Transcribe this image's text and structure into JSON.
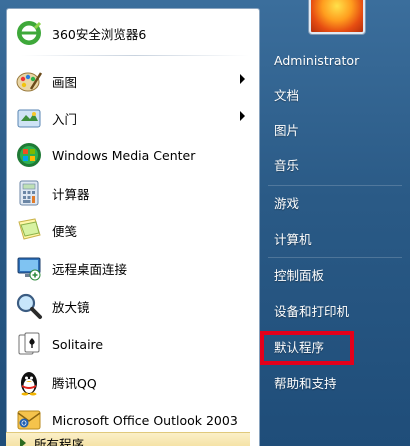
{
  "pinned": [
    {
      "label": "360安全浏览器6",
      "icon": "360-browser-icon"
    }
  ],
  "programs": [
    {
      "label": "画图",
      "icon": "paint-icon",
      "submenu": true
    },
    {
      "label": "入门",
      "icon": "getting-started-icon",
      "submenu": true
    },
    {
      "label": "Windows Media Center",
      "icon": "media-center-icon",
      "submenu": false
    },
    {
      "label": "计算器",
      "icon": "calculator-icon",
      "submenu": false
    },
    {
      "label": "便笺",
      "icon": "sticky-notes-icon",
      "submenu": false
    },
    {
      "label": "远程桌面连接",
      "icon": "remote-desktop-icon",
      "submenu": false
    },
    {
      "label": "放大镜",
      "icon": "magnifier-icon",
      "submenu": false
    },
    {
      "label": "Solitaire",
      "icon": "solitaire-icon",
      "submenu": false
    },
    {
      "label": "腾讯QQ",
      "icon": "qq-penguin-icon",
      "submenu": false
    },
    {
      "label": "Microsoft Office Outlook 2003",
      "icon": "outlook-icon",
      "submenu": false
    }
  ],
  "all_programs": {
    "label": "所有程序"
  },
  "right_menu": [
    {
      "label": "Administrator"
    },
    {
      "label": "文档"
    },
    {
      "label": "图片"
    },
    {
      "label": "音乐"
    },
    {
      "label": "游戏"
    },
    {
      "label": "计算机"
    },
    {
      "label": "控制面板"
    },
    {
      "label": "设备和打印机"
    },
    {
      "label": "默认程序"
    },
    {
      "label": "帮助和支持"
    }
  ],
  "highlight": {
    "target": "默认程序",
    "color": "#e3001b"
  }
}
